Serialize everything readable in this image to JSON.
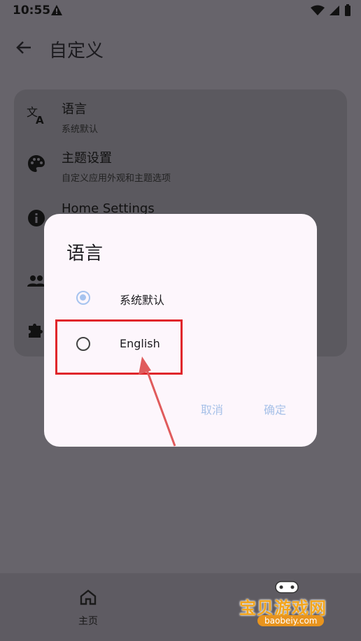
{
  "status": {
    "time": "10:55"
  },
  "appbar": {
    "title": "自定义"
  },
  "settings": {
    "items": [
      {
        "title": "语言",
        "subtitle": "系统默认",
        "icon": "translate-icon"
      },
      {
        "title": "主题设置",
        "subtitle": "自定义应用外观和主题选项",
        "icon": "palette-icon"
      },
      {
        "title": "Home Settings",
        "subtitle": "",
        "icon": "info-icon"
      },
      {
        "title": "",
        "subtitle": "",
        "icon": "people-icon"
      },
      {
        "title": "",
        "subtitle": "",
        "icon": "puzzle-icon"
      }
    ]
  },
  "dialog": {
    "title": "语言",
    "options": [
      {
        "label": "系统默认",
        "selected": true
      },
      {
        "label": "English",
        "selected": false
      }
    ],
    "cancel": "取消",
    "confirm": "确定"
  },
  "bottomnav": {
    "home_label": "主页"
  },
  "watermark": {
    "text": "宝贝游戏网",
    "url": "baobeiy.com"
  },
  "colors": {
    "accent": "#a6c3ef",
    "annotation": "#e0262b"
  }
}
